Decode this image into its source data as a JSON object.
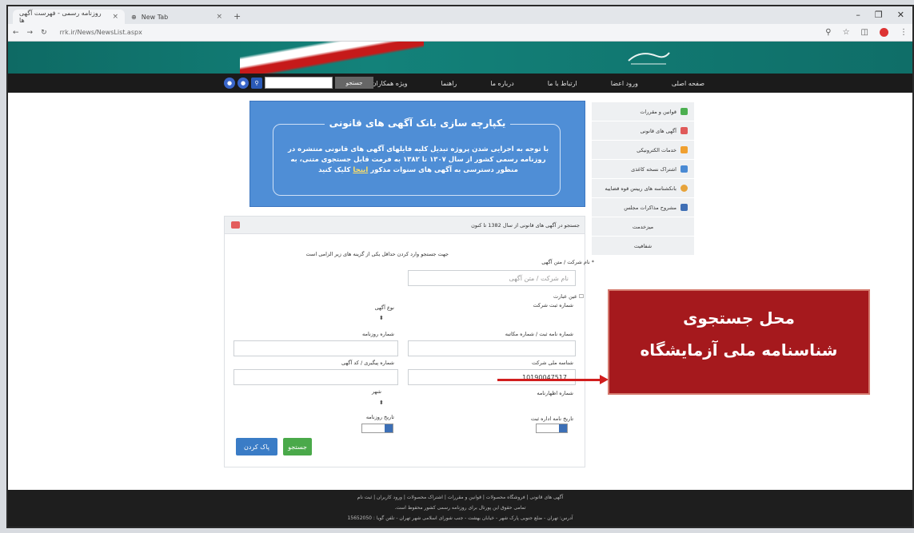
{
  "browser": {
    "tabs": [
      {
        "label": "روزنامه رسمی - فهرست آگهی ها"
      },
      {
        "label": "New Tab"
      }
    ],
    "url": "rrk.ir/News/NewsList.aspx"
  },
  "nav": {
    "items": [
      "صفحه اصلی",
      "ورود اعضا",
      "ارتباط با ما",
      "درباره ما",
      "راهنما",
      "ویژه همکاران"
    ],
    "search_button": "جستجو"
  },
  "sidebar": {
    "items": [
      {
        "label": "قوانین و مقررات",
        "icon": "document-icon",
        "color": "#4caf50"
      },
      {
        "label": "آگهی های قانونی",
        "icon": "newspaper-icon",
        "color": "#e05a5a"
      },
      {
        "label": "خدمات الکترونیکی",
        "icon": "tools-icon",
        "color": "#f0a030"
      },
      {
        "label": "اشتراک نسخه کاغذی",
        "icon": "subscription-icon",
        "color": "#4a8ad4"
      },
      {
        "label": "بانکشناسه های رییس قوه قضاییه",
        "icon": "bank-icon",
        "color": "#e7a33a"
      },
      {
        "label": "مشروح مذاکرات مجلس",
        "icon": "parliament-icon",
        "color": "#3f6fb5"
      },
      {
        "label": "میزخدمت"
      },
      {
        "label": "شفافیت"
      }
    ]
  },
  "promo": {
    "title": "یکپارچه سازی بانک آگهی های قانونی",
    "text": "با توجه به اجرایی شدن پروژه تبدیل کلیه فایلهای آگهی های قانونی منتشره در روزنامه رسمی کشور از سال ۱۳۰۷ تا ۱۳۸۲ به فرمت قابل جستجوی متنی، به منظور دسترسی به آگهی های سنوات مذکور",
    "link": "اینجا",
    "after": "کلیک کنید"
  },
  "form": {
    "title": "جستجو در آگهی های قانونی از سال 1382 تا کنون",
    "hint": "جهت جستجو وارد کردن حداقل یکی از گزینه های زیر الزامی است",
    "company_label": "* نام شرکت / متن آگهی",
    "company_placeholder": "نام شرکت / متن آگهی",
    "exact_label": "عین عبارت",
    "reg_label": "شماره ثبت شرکت",
    "type_label": "نوع آگهی",
    "letter_label": "شماره نامه ثبت / شماره مکاتبه",
    "newspaper_label": "شماره روزنامه",
    "national_label": "شناسه ملی شرکت",
    "national_value": "10190047517",
    "tracking_label": "شماره پیگیری / کد آگهی",
    "gazette_label": "شماره اظهارنامه",
    "city_label": "شهر",
    "date_label": "تاریخ نامه اداره ثبت",
    "paper_date_label": "تاریخ روزنامه",
    "search_button": "جستجو",
    "clear_button": "پاک کردن"
  },
  "footer": {
    "links": "آگهی های قانونی | فروشگاه محصولات | قوانین و مقررات | اشتراک محصولات | ورود کاربران | ثبت نام",
    "copyright": "تمامی حقوق این پورتال برای روزنامه رسمی کشور محفوظ است.",
    "address": "آدرس: تهران - ضلع جنوبی پارک شهر - خیابان بهشت - جنب شورای اسلامی شهر تهران - تلفن گویا : 15652050"
  },
  "callout": {
    "line1": "محل جستجوی",
    "line2": "شناسنامه ملی آزمایشگاه"
  }
}
